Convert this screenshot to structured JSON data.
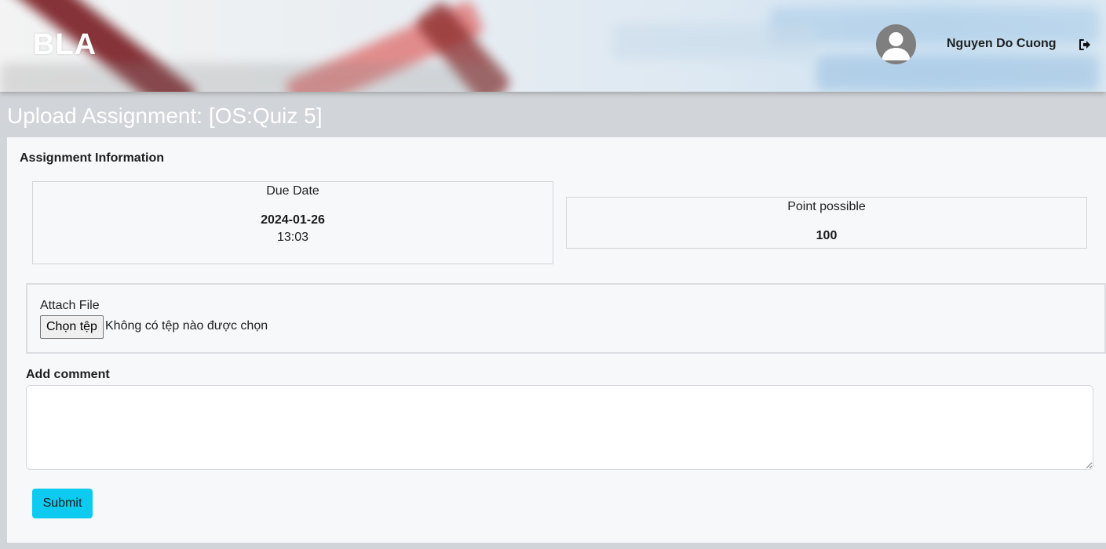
{
  "header": {
    "logo": "BLA",
    "user_name": "Nguyen Do Cuong",
    "avatar_icon": "user-avatar-icon",
    "logout_icon": "sign-out-icon"
  },
  "page": {
    "title": "Upload Assignment: [OS:Quiz 5]"
  },
  "assignment_info": {
    "section_title": "Assignment Information",
    "due_date_label": "Due Date",
    "due_date": "2024-01-26",
    "due_time": "13:03",
    "points_label": "Point possible",
    "points": "100"
  },
  "attach": {
    "label": "Attach File",
    "button_label": "Chọn tệp",
    "status": "Không có tệp nào được chọn"
  },
  "comment": {
    "label": "Add comment",
    "value": ""
  },
  "submit": {
    "label": "Submit"
  },
  "colors": {
    "accent": "#0dcaf0",
    "page_bg": "#d1d4d8",
    "panel_bg": "#f7f8fa"
  }
}
